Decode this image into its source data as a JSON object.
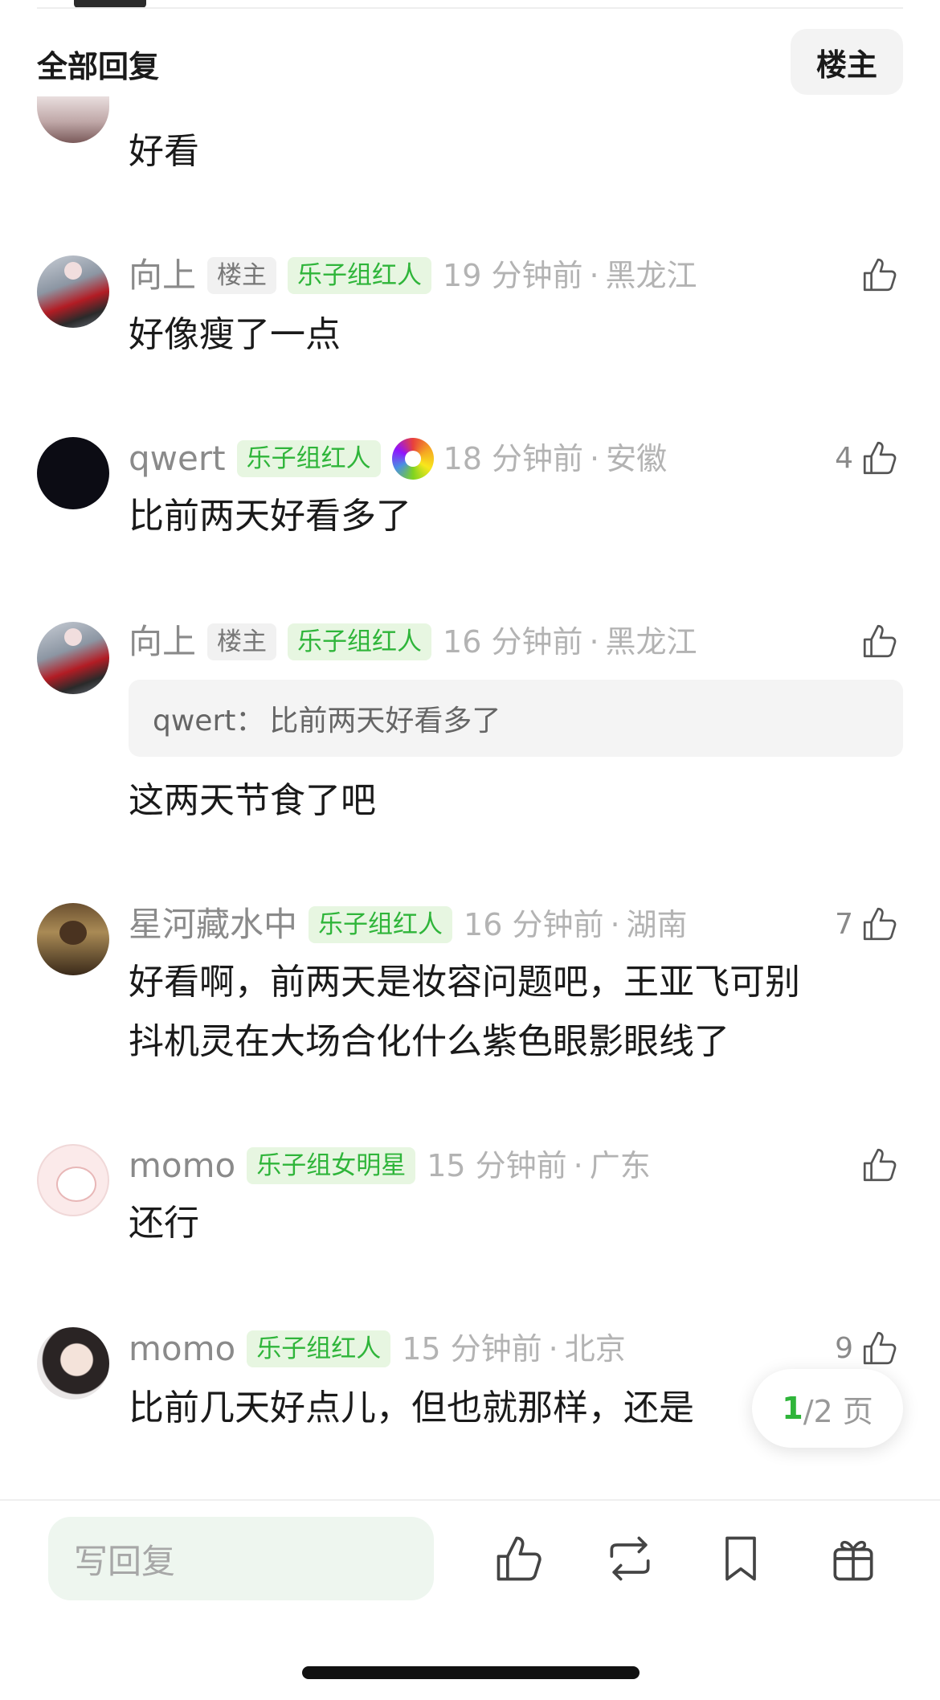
{
  "header": {
    "title": "全部回复",
    "filter_label": "楼主"
  },
  "comments": [
    {
      "text": "好看"
    },
    {
      "username": "向上",
      "badge_owner": "楼主",
      "badge_group": "乐子组红人",
      "time": "19 分钟前",
      "location": "黑龙江",
      "text": "好像瘦了一点",
      "likes": ""
    },
    {
      "username": "qwert",
      "badge_group": "乐子组红人",
      "time": "18 分钟前",
      "location": "安徽",
      "text": "比前两天好看多了",
      "likes": "4"
    },
    {
      "username": "向上",
      "badge_owner": "楼主",
      "badge_group": "乐子组红人",
      "time": "16 分钟前",
      "location": "黑龙江",
      "quote_user": "qwert：",
      "quote_text": "比前两天好看多了",
      "text": "这两天节食了吧",
      "likes": ""
    },
    {
      "username": "星河藏水中",
      "badge_group": "乐子组红人",
      "time": "16 分钟前",
      "location": "湖南",
      "text_line1": "好看啊，前两天是妆容问题吧，王亚飞可别",
      "text_line2": "抖机灵在大场合化什么紫色眼影眼线了",
      "likes": "7"
    },
    {
      "username": "momo",
      "badge_group": "乐子组女明星",
      "time": "15 分钟前",
      "location": "广东",
      "text": "还行",
      "likes": ""
    },
    {
      "username": "momo",
      "badge_group": "乐子组红人",
      "time": "15 分钟前",
      "location": "北京",
      "text": "比前几天好点儿，但也就那样，还是",
      "likes": "9"
    }
  ],
  "separator": "·",
  "pager": {
    "current": "1",
    "rest": "/2 页"
  },
  "bottom_bar": {
    "reply_placeholder": "写回复"
  },
  "colors": {
    "accent_green": "#2fb53a",
    "badge_green_bg": "#e7f6e1",
    "muted": "#b3b3b3"
  }
}
